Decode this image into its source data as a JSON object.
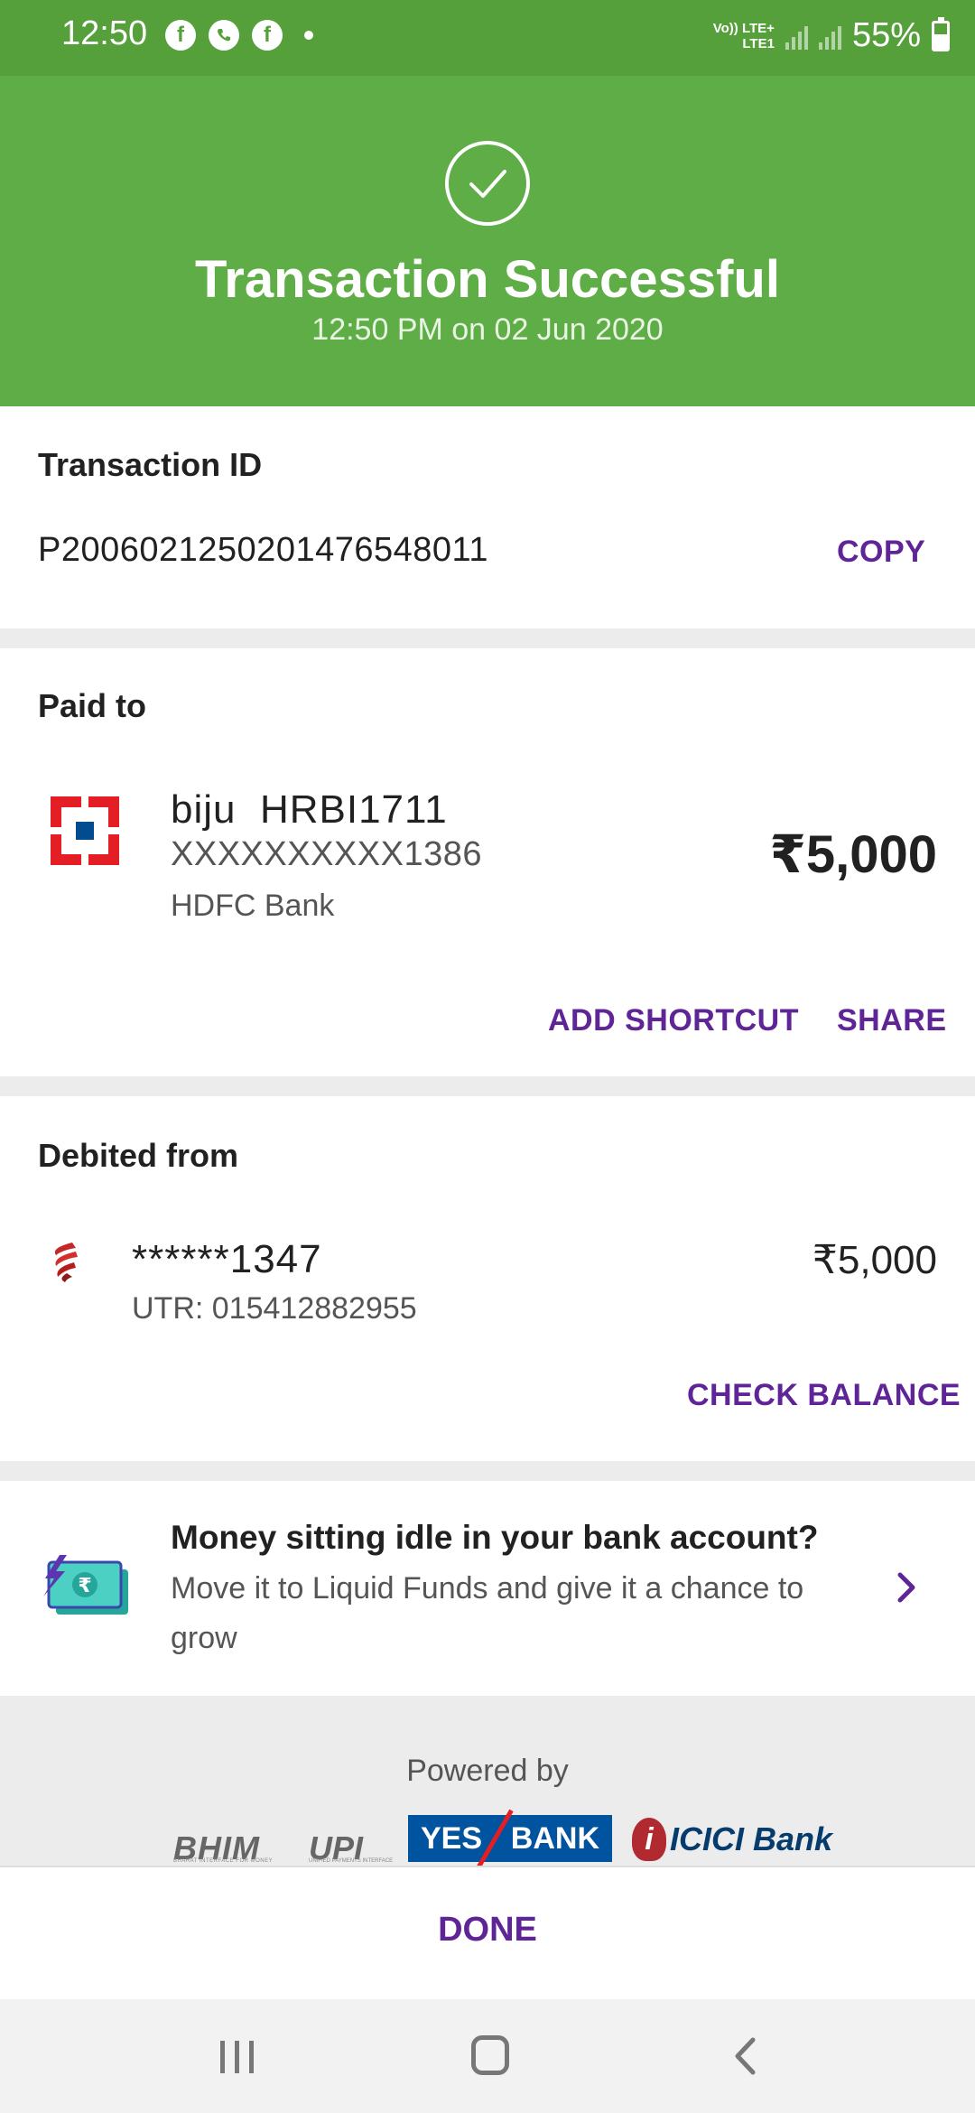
{
  "status_bar": {
    "time": "12:50",
    "network_top": "Vo)) LTE+",
    "network_bottom": "LTE1",
    "battery": "55%"
  },
  "header": {
    "title": "Transaction Successful",
    "subtitle": "12:50 PM on 02 Jun 2020",
    "background_color": "#5fad46"
  },
  "transaction": {
    "label": "Transaction ID",
    "id": "P2006021250201476548011",
    "copy_label": "COPY"
  },
  "paid_to": {
    "label": "Paid to",
    "name": "biju  HRBI1711",
    "account": "XXXXXXXXXX1386",
    "bank": "HDFC Bank",
    "amount": "₹5,000",
    "add_shortcut_label": "ADD SHORTCUT",
    "share_label": "SHARE"
  },
  "debited_from": {
    "label": "Debited from",
    "account": "******1347",
    "utr": "UTR: 015412882955",
    "amount": "₹5,000",
    "check_balance_label": "CHECK BALANCE"
  },
  "promo": {
    "title": "Money sitting idle in your bank account?",
    "description": "Move it to Liquid Funds and give it a chance to grow"
  },
  "powered_by": {
    "label": "Powered by",
    "bhim": "BHIM",
    "bhim_sub": "BHARAT INTERFACE FOR MONEY",
    "upi": "UPI",
    "upi_sub": "UNIFIED PAYMENTS INTERFACE",
    "yes_left": "YES",
    "yes_right": "BANK",
    "icici_mark": "i",
    "icici": "ICICI Bank"
  },
  "footer": {
    "done_label": "DONE"
  },
  "colors": {
    "accent": "#5f2597",
    "success_green": "#5fad46",
    "status_bar_green": "#56a03c"
  }
}
